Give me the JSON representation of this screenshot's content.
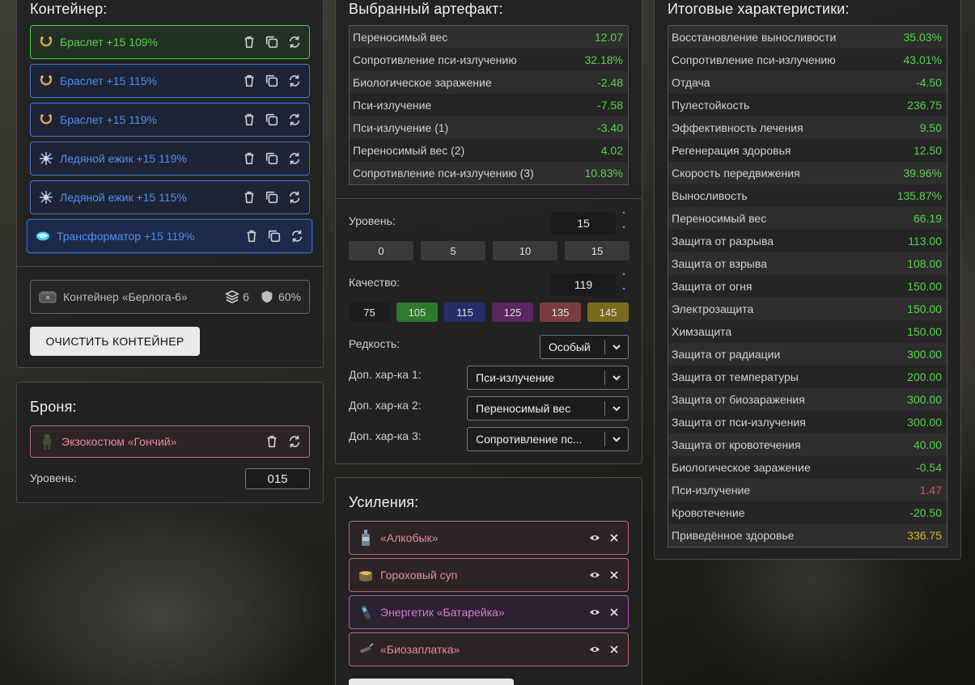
{
  "container": {
    "title": "Контейнер:",
    "items": [
      {
        "label": "Браслет +15 109%",
        "icon": "bracelet-icon",
        "style": "green"
      },
      {
        "label": "Браслет +15 115%",
        "icon": "bracelet-icon",
        "style": "blue"
      },
      {
        "label": "Браслет +15 119%",
        "icon": "bracelet-icon",
        "style": "blue"
      },
      {
        "label": "Ледяной ежик +15 119%",
        "icon": "ice-hedgehog-icon",
        "style": "blue"
      },
      {
        "label": "Ледяной ежик +15 115%",
        "icon": "ice-hedgehog-icon",
        "style": "blue"
      },
      {
        "label": "Трансформатор +15 119%",
        "icon": "transformer-icon",
        "style": "selected"
      }
    ],
    "box": {
      "name": "Контейнер «Берлога-6»",
      "slots": "6",
      "protection": "60%"
    },
    "clear_button": "ОЧИСТИТЬ КОНТЕЙНЕР"
  },
  "armor": {
    "title": "Броня:",
    "item": "Экзокостюм «Гончий»",
    "level_label": "Уровень:",
    "level_value": "015"
  },
  "artifact": {
    "title": "Выбранный артефакт:",
    "stats": [
      {
        "name": "Переносимый вес",
        "value": "12.07"
      },
      {
        "name": "Сопротивление пси-излучению",
        "value": "32.18%"
      },
      {
        "name": "Биологическое заражение",
        "value": "-2.48"
      },
      {
        "name": "Пси-излучение",
        "value": "-7.58"
      },
      {
        "name": "Пси-излучение (1)",
        "value": "-3.40"
      },
      {
        "name": "Переносимый вес (2)",
        "value": "4.02"
      },
      {
        "name": "Сопротивление пси-излучению (3)",
        "value": "10.83%"
      }
    ],
    "level_label": "Уровень:",
    "level_value": "15",
    "level_presets": [
      "0",
      "5",
      "10",
      "15"
    ],
    "quality_label": "Качество:",
    "quality_value": "119",
    "quality_presets": [
      {
        "label": "75",
        "color": "#1c1c1c"
      },
      {
        "label": "105",
        "color": "#2f7a2f"
      },
      {
        "label": "115",
        "color": "#262e6a"
      },
      {
        "label": "125",
        "color": "#5a2560"
      },
      {
        "label": "135",
        "color": "#7a3d3f"
      },
      {
        "label": "145",
        "color": "#7a6a1e"
      }
    ],
    "rarity_label": "Редкость:",
    "rarity_value": "Особый",
    "extra1_label": "Доп. хар-ка 1:",
    "extra1_value": "Пси-излучение",
    "extra2_label": "Доп. хар-ка 2:",
    "extra2_value": "Переносимый вес",
    "extra3_label": "Доп. хар-ка 3:",
    "extra3_value": "Сопротивление пс..."
  },
  "boosts": {
    "title": "Усиления:",
    "items": [
      {
        "label": "«Алкобык»",
        "icon": "bottle-icon",
        "style": "red"
      },
      {
        "label": "Гороховый суп",
        "icon": "soup-icon",
        "style": "red"
      },
      {
        "label": "Энергетик «Батарейка»",
        "icon": "energy-drink-icon",
        "style": "purple"
      },
      {
        "label": "«Биозаплатка»",
        "icon": "syringe-icon",
        "style": "red"
      }
    ]
  },
  "totals": {
    "title": "Итоговые характеристики:",
    "stats": [
      {
        "name": "Восстановление выносливости",
        "value": "35.03%",
        "color": "green"
      },
      {
        "name": "Сопротивление пси-излучению",
        "value": "43.01%",
        "color": "green"
      },
      {
        "name": "Отдача",
        "value": "-4.50",
        "color": "green"
      },
      {
        "name": "Пулестойкость",
        "value": "236.75",
        "color": "green"
      },
      {
        "name": "Эффективность лечения",
        "value": "9.50",
        "color": "green"
      },
      {
        "name": "Регенерация здоровья",
        "value": "12.50",
        "color": "green"
      },
      {
        "name": "Скорость передвижения",
        "value": "39.96%",
        "color": "green"
      },
      {
        "name": "Выносливость",
        "value": "135.87%",
        "color": "green"
      },
      {
        "name": "Переносимый вес",
        "value": "66.19",
        "color": "green"
      },
      {
        "name": "Защита от разрыва",
        "value": "113.00",
        "color": "green"
      },
      {
        "name": "Защита от взрыва",
        "value": "108.00",
        "color": "green"
      },
      {
        "name": "Защита от огня",
        "value": "150.00",
        "color": "green"
      },
      {
        "name": "Электрозащита",
        "value": "150.00",
        "color": "green"
      },
      {
        "name": "Химзащита",
        "value": "150.00",
        "color": "green"
      },
      {
        "name": "Защита от радиации",
        "value": "300.00",
        "color": "green"
      },
      {
        "name": "Защита от температуры",
        "value": "200.00",
        "color": "green"
      },
      {
        "name": "Защита от биозаражения",
        "value": "300.00",
        "color": "green"
      },
      {
        "name": "Защита от пси-излучения",
        "value": "300.00",
        "color": "green"
      },
      {
        "name": "Защита от кровотечения",
        "value": "40.00",
        "color": "green"
      },
      {
        "name": "Биологическое заражение",
        "value": "-0.54",
        "color": "green"
      },
      {
        "name": "Пси-излучение",
        "value": "1.47",
        "color": "red"
      },
      {
        "name": "Кровотечение",
        "value": "-20.50",
        "color": "green"
      },
      {
        "name": "Приведённое здоровье",
        "value": "336.75",
        "color": "gold"
      }
    ]
  }
}
